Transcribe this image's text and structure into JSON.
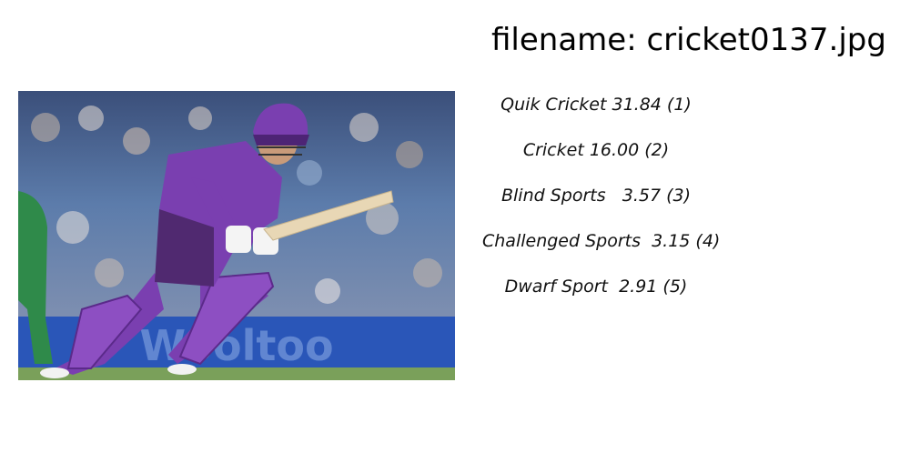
{
  "header": {
    "title": "filename: cricket0137.jpg"
  },
  "predictions": [
    {
      "text": "Quik Cricket 31.84 (1)"
    },
    {
      "text": "Cricket 16.00 (2)"
    },
    {
      "text": "Blind Sports   3.57 (3)"
    },
    {
      "text": "Challenged Sports  3.15 (4)"
    },
    {
      "text": "Dwarf Sport  2.91 (5)"
    }
  ],
  "photo": {
    "description_icon": "cricket-batsman-photo",
    "banner_text": "Wooltoo"
  },
  "colors": {
    "jersey_purple": "#7a3fb0",
    "crowd_blue": "#4a6fa5",
    "banner_blue": "#2a56b8",
    "grass_green": "#7aa05a"
  }
}
